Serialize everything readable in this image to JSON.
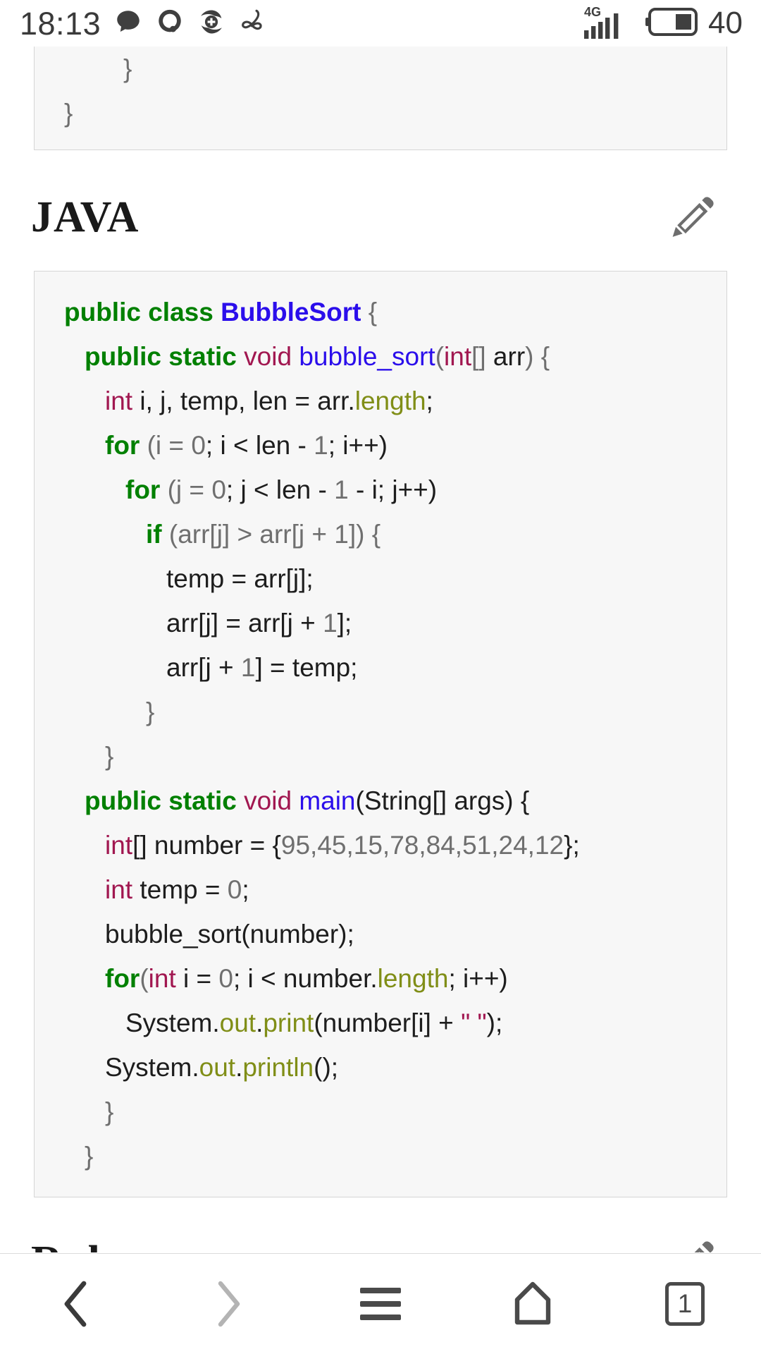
{
  "statusbar": {
    "time": "18:13",
    "battery_percent": "40",
    "network": "4G",
    "icons": [
      "chat-bubble-icon",
      "qq-icon",
      "health-plus-icon",
      "ribbon-loop-icon"
    ]
  },
  "top_code_block": {
    "lines": [
      {
        "indent": 3,
        "text": "}"
      },
      {
        "indent": 0,
        "text": "}"
      }
    ]
  },
  "java_section": {
    "title": "JAVA",
    "edit_icon": "pencil-icon",
    "code": [
      {
        "indent": 0,
        "tokens": [
          {
            "t": "public class ",
            "c": "kw"
          },
          {
            "t": "BubbleSort",
            "c": "typ"
          },
          {
            "t": " {",
            "c": "pun"
          }
        ]
      },
      {
        "indent": 1,
        "tokens": [
          {
            "t": "public static ",
            "c": "kw"
          },
          {
            "t": "void ",
            "c": "prim"
          },
          {
            "t": "bubble_sort",
            "c": "fn"
          },
          {
            "t": "(",
            "c": "pun"
          },
          {
            "t": "int",
            "c": "prim"
          },
          {
            "t": "[]",
            "c": "pun"
          },
          {
            "t": " arr",
            "c": "pl"
          },
          {
            "t": ") {",
            "c": "pun"
          }
        ]
      },
      {
        "indent": 2,
        "tokens": [
          {
            "t": "int",
            "c": "prim"
          },
          {
            "t": " i, j, temp, len = arr.",
            "c": "pl"
          },
          {
            "t": "length",
            "c": "fld"
          },
          {
            "t": ";",
            "c": "pl"
          }
        ]
      },
      {
        "indent": 2,
        "tokens": [
          {
            "t": "for",
            "c": "ctl"
          },
          {
            "t": " (i = ",
            "c": "pun"
          },
          {
            "t": "0",
            "c": "num"
          },
          {
            "t": "; i < len - ",
            "c": "pl"
          },
          {
            "t": "1",
            "c": "num"
          },
          {
            "t": "; i++)",
            "c": "pl"
          }
        ]
      },
      {
        "indent": 3,
        "tokens": [
          {
            "t": "for",
            "c": "ctl"
          },
          {
            "t": " (j = ",
            "c": "pun"
          },
          {
            "t": "0",
            "c": "num"
          },
          {
            "t": "; j < len - ",
            "c": "pl"
          },
          {
            "t": "1",
            "c": "num"
          },
          {
            "t": " - i; j++)",
            "c": "pl"
          }
        ]
      },
      {
        "indent": 4,
        "tokens": [
          {
            "t": "if",
            "c": "ctl"
          },
          {
            "t": " (arr[j] > arr[j + ",
            "c": "pun"
          },
          {
            "t": "1",
            "c": "num"
          },
          {
            "t": "]) {",
            "c": "pun"
          }
        ]
      },
      {
        "indent": 5,
        "tokens": [
          {
            "t": "temp = arr[j];",
            "c": "pl"
          }
        ]
      },
      {
        "indent": 5,
        "tokens": [
          {
            "t": "arr[j] = arr[j + ",
            "c": "pl"
          },
          {
            "t": "1",
            "c": "num"
          },
          {
            "t": "];",
            "c": "pl"
          }
        ]
      },
      {
        "indent": 5,
        "tokens": [
          {
            "t": "arr[j + ",
            "c": "pl"
          },
          {
            "t": "1",
            "c": "num"
          },
          {
            "t": "] = temp;",
            "c": "pl"
          }
        ]
      },
      {
        "indent": 4,
        "tokens": [
          {
            "t": "}",
            "c": "pun"
          }
        ]
      },
      {
        "indent": 2,
        "tokens": [
          {
            "t": "}",
            "c": "pun"
          }
        ]
      },
      {
        "indent": 1,
        "tokens": [
          {
            "t": "public static ",
            "c": "kw"
          },
          {
            "t": "void ",
            "c": "prim"
          },
          {
            "t": "main",
            "c": "fn"
          },
          {
            "t": "(String[] args) {",
            "c": "pl"
          }
        ]
      },
      {
        "indent": 2,
        "tokens": [
          {
            "t": "int",
            "c": "prim"
          },
          {
            "t": "[] number = {",
            "c": "pl"
          },
          {
            "t": "95,45,15,78,84,51,24,12",
            "c": "num"
          },
          {
            "t": "};",
            "c": "pl"
          }
        ]
      },
      {
        "indent": 2,
        "tokens": [
          {
            "t": "int",
            "c": "prim"
          },
          {
            "t": " temp = ",
            "c": "pl"
          },
          {
            "t": "0",
            "c": "num"
          },
          {
            "t": ";",
            "c": "pl"
          }
        ]
      },
      {
        "indent": 2,
        "tokens": [
          {
            "t": "bubble_sort(number);",
            "c": "pl"
          }
        ]
      },
      {
        "indent": 2,
        "tokens": [
          {
            "t": "for",
            "c": "ctl"
          },
          {
            "t": "(",
            "c": "pun"
          },
          {
            "t": "int",
            "c": "prim"
          },
          {
            "t": " i = ",
            "c": "pl"
          },
          {
            "t": "0",
            "c": "num"
          },
          {
            "t": "; i < number.",
            "c": "pl"
          },
          {
            "t": "length",
            "c": "fld"
          },
          {
            "t": "; i++)",
            "c": "pl"
          }
        ]
      },
      {
        "indent": 3,
        "tokens": [
          {
            "t": "System.",
            "c": "pl"
          },
          {
            "t": "out",
            "c": "fld"
          },
          {
            "t": ".",
            "c": "pl"
          },
          {
            "t": "print",
            "c": "fld"
          },
          {
            "t": "(number[i] + ",
            "c": "pl"
          },
          {
            "t": "\" \"",
            "c": "str"
          },
          {
            "t": ");",
            "c": "pl"
          }
        ]
      },
      {
        "indent": 2,
        "tokens": [
          {
            "t": "System.",
            "c": "pl"
          },
          {
            "t": "out",
            "c": "fld"
          },
          {
            "t": ".",
            "c": "pl"
          },
          {
            "t": "println",
            "c": "fld"
          },
          {
            "t": "();",
            "c": "pl"
          }
        ]
      },
      {
        "indent": 2,
        "tokens": [
          {
            "t": "}",
            "c": "pun"
          }
        ]
      },
      {
        "indent": 1,
        "tokens": [
          {
            "t": "}",
            "c": "pun"
          }
        ]
      }
    ]
  },
  "ruby_section": {
    "title": "Ruby",
    "edit_icon": "pencil-icon"
  },
  "navbar": {
    "items": [
      {
        "name": "back-button",
        "icon": "chevron-left-icon"
      },
      {
        "name": "forward-button",
        "icon": "chevron-right-icon"
      },
      {
        "name": "menu-button",
        "icon": "hamburger-icon"
      },
      {
        "name": "home-button",
        "icon": "home-icon"
      },
      {
        "name": "tabs-button",
        "icon": "tab-count-icon"
      }
    ],
    "tab_count": "1"
  },
  "colors": {
    "keyword": "#008000",
    "classname": "#2b0eeb",
    "primitive": "#a11750",
    "field": "#808e17",
    "number": "#6f6f6f",
    "codebg": "#f7f7f7"
  }
}
